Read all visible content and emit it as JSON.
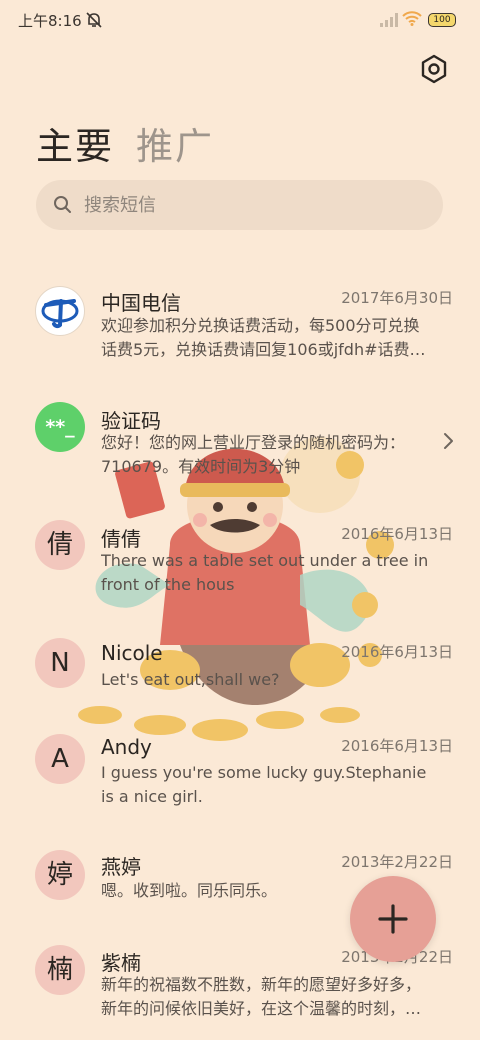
{
  "status_bar": {
    "time": "上午8:16",
    "battery": "100"
  },
  "tabs": {
    "main": "主要",
    "promo": "推广"
  },
  "search": {
    "placeholder": "搜索短信"
  },
  "messages": [
    {
      "name": "中国电信",
      "date": "2017年6月30日",
      "line1": "欢迎参加积分兑换话费活动，每500分可兑换",
      "line2": "话费5元，兑换话费请回复106或jfdh#话费…",
      "avatar": ""
    },
    {
      "name": "验证码",
      "date": "",
      "line1": "您好！您的网上营业厅登录的随机密码为：",
      "line2": "710679。有效时间为3分钟",
      "avatar": "**_"
    },
    {
      "name": "倩倩",
      "date": "2016年6月13日",
      "line1": "There was a table set out under a tree in",
      "line2": "front of the hous",
      "avatar": "倩"
    },
    {
      "name": "Nicole",
      "date": "2016年6月13日",
      "line1": "Let's eat out,shall we?",
      "line2": "",
      "avatar": "N"
    },
    {
      "name": "Andy",
      "date": "2016年6月13日",
      "line1": "I guess you're some lucky guy.Stephanie",
      "line2": "is a nice girl.",
      "avatar": "A"
    },
    {
      "name": "燕婷",
      "date": "2013年2月22日",
      "line1": "嗯。收到啦。同乐同乐。",
      "line2": "",
      "avatar": "婷"
    },
    {
      "name": "紫楠",
      "date": "2013年2月22日",
      "line1": "新年的祝福数不胜数，新年的愿望好多好多，",
      "line2": "新年的问候依旧美好，在这个温馨的时刻，…",
      "avatar": "楠"
    }
  ],
  "colors": {
    "background": "#fbe9d6",
    "fab": "#e6a096",
    "green_avatar": "#5ed06a",
    "telecom_blue": "#1d5bb8"
  }
}
